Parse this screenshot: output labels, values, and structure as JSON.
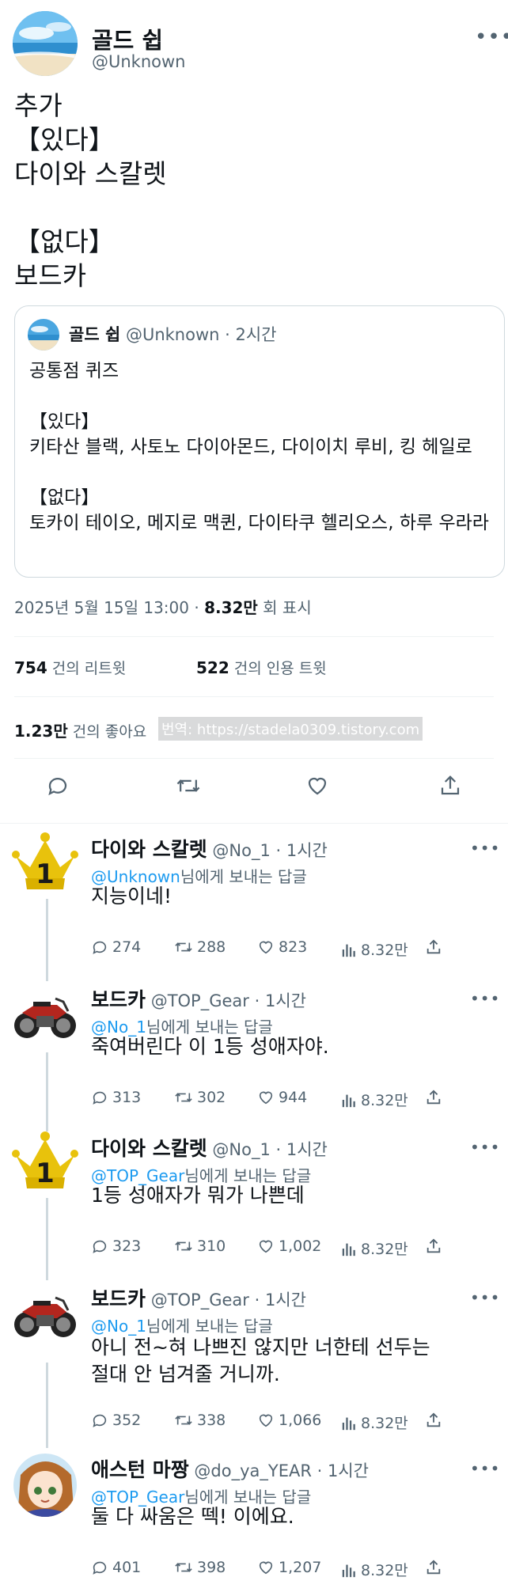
{
  "tweet": {
    "author_name": "골드 쉽",
    "author_handle": "@Unknown",
    "more_icon": "more-icon",
    "text": "추가\n【있다】\n다이와 스칼렛\n\n【없다】\n보드카",
    "quote": {
      "author_name": "골드 쉽",
      "author_handle": "@Unknown",
      "time": "· 2시간",
      "text": "공통점 퀴즈\n\n【있다】\n키타산 블랙, 사토노 다이아몬드, 다이이치 루비, 킹 헤일로\n\n【없다】\n토카이 테이오, 메지로 맥퀸, 다이타쿠 헬리오스, 하루 우라라"
    },
    "timestamp": "2025년 5월 15일  13:00 · ",
    "views_count": "8.32만",
    "views_label": " 회 표시",
    "retweets_count": "754",
    "retweets_label": " 건의 리트윗",
    "quotes_count": "522",
    "quotes_label": " 건의 인용 트윗",
    "likes_count": "1.23만",
    "likes_label": " 건의 좋아요",
    "watermark": "번역: https://stadela0309.tistory.com"
  },
  "actions": {
    "reply_icon": "reply-icon",
    "retweet_icon": "retweet-icon",
    "like_icon": "heart-icon",
    "share_icon": "share-icon"
  },
  "replies": [
    {
      "name": "다이와 스칼렛",
      "handle": "@No_1",
      "time": "· 1시간",
      "to": "@Unknown",
      "to_suffix": "님에게 보내는 답글",
      "text": "지능이네!",
      "replies": "274",
      "retweets": "288",
      "likes": "823",
      "views": "8.32만",
      "avatar": "crown-1-avatar"
    },
    {
      "name": "보드카",
      "handle": "@TOP_Gear",
      "time": "· 1시간",
      "to": "@No_1",
      "to_suffix": "님에게 보내는 답글",
      "text": "죽여버린다 이 1등 성애자야.",
      "replies": "313",
      "retweets": "302",
      "likes": "944",
      "views": "8.32만",
      "avatar": "motorcycle-avatar"
    },
    {
      "name": "다이와 스칼렛",
      "handle": "@No_1",
      "time": "· 1시간",
      "to": "@TOP_Gear",
      "to_suffix": "님에게 보내는 답글",
      "text": "1등 성애자가 뭐가 나쁜데",
      "replies": "323",
      "retweets": "310",
      "likes": "1,002",
      "views": "8.32만",
      "avatar": "crown-1-avatar"
    },
    {
      "name": "보드카",
      "handle": "@TOP_Gear",
      "time": "· 1시간",
      "to": "@No_1",
      "to_suffix": "님에게 보내는 답글",
      "text": "아니 전~혀 나쁘진 않지만 너한테 선두는\n절대 안 넘겨줄 거니까.",
      "replies": "352",
      "retweets": "338",
      "likes": "1,066",
      "views": "8.32만",
      "avatar": "motorcycle-avatar"
    },
    {
      "name": "애스턴 마짱",
      "handle": "@do_ya_YEAR",
      "time": "· 1시간",
      "to": "@TOP_Gear",
      "to_suffix": "님에게 보내는 답글",
      "text": "둘 다 싸움은 떽! 이에요.",
      "replies": "401",
      "retweets": "398",
      "likes": "1,207",
      "views": "8.32만",
      "avatar": "anime-girl-avatar"
    }
  ]
}
